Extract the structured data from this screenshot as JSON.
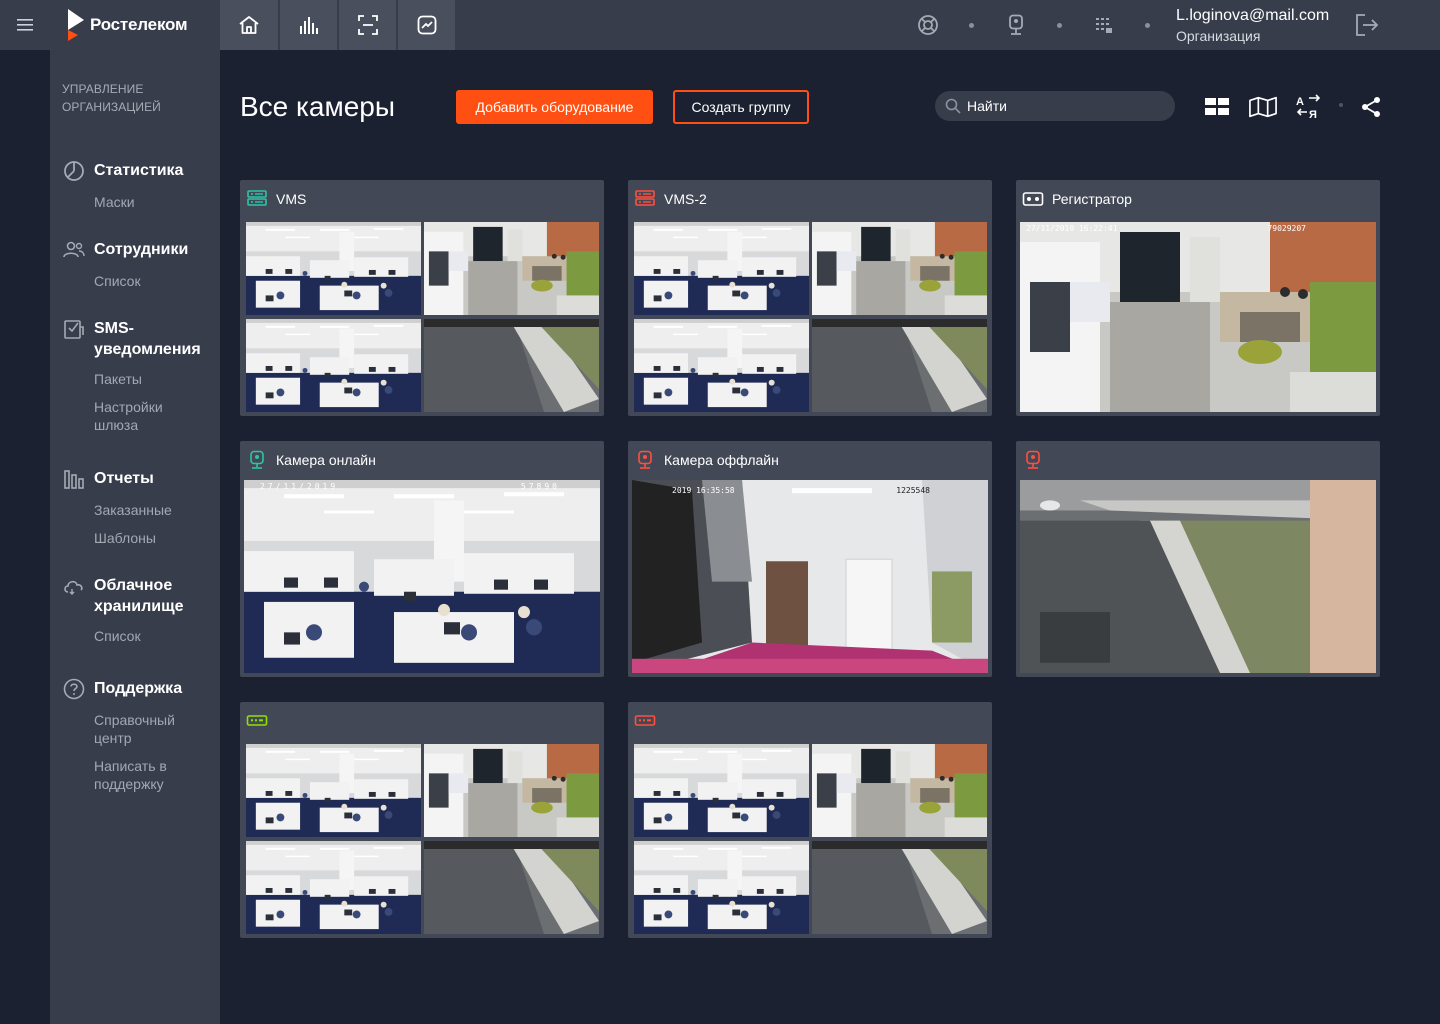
{
  "brand": {
    "name": "Ростелеком",
    "logo_accent": "#ff4f12"
  },
  "topnav": {
    "tabs": [
      {
        "icon": "home-icon"
      },
      {
        "icon": "bar-chart-icon"
      },
      {
        "icon": "scan-icon"
      },
      {
        "icon": "analytics-icon"
      }
    ],
    "tools": [
      {
        "icon": "lifebuoy-icon"
      },
      {
        "icon": "camera-icon"
      },
      {
        "icon": "building-icon"
      }
    ],
    "user_email": "L.loginova@mail.com",
    "user_org": "Организация",
    "logout_icon": "logout-icon"
  },
  "sidebar": {
    "section_line1": "Управление",
    "section_line2": "организацией",
    "groups": [
      {
        "icon": "chart-icon",
        "title": "Статистика",
        "items": [
          "Маски"
        ]
      },
      {
        "icon": "users-icon",
        "title": "Сотрудники",
        "items": [
          "Список"
        ]
      },
      {
        "icon": "sms-icon",
        "title": "SMS-уведомления",
        "title_line1": "SMS-",
        "title_line2": "уведомления",
        "items": [
          "Пакеты",
          "Настройки шлюза"
        ]
      },
      {
        "icon": "reports-icon",
        "title": "Отчеты",
        "items": [
          "Заказанные",
          "Шаблоны"
        ]
      },
      {
        "icon": "cloud-icon",
        "title": "Облачное хранилище",
        "title_line1": "Облачное",
        "title_line2": "хранилище",
        "items": [
          "Список"
        ]
      },
      {
        "icon": "help-icon",
        "title": "Поддержка",
        "items": [
          "Справочный центр",
          "Написать в поддержку"
        ]
      }
    ]
  },
  "main": {
    "title": "Все камеры",
    "add_button": "Добавить оборудование",
    "group_button": "Создать группу",
    "search_placeholder": "Найти",
    "view_controls": [
      "grid-view-icon",
      "map-view-icon",
      "sort-az-icon",
      "share-icon"
    ]
  },
  "tiles": [
    {
      "name": "VMS",
      "icon": "server-icon",
      "icon_color": "#2ec4a6",
      "kind": "grid"
    },
    {
      "name": "VMS-2",
      "icon": "server-icon",
      "icon_color": "#ff4f3d",
      "kind": "grid"
    },
    {
      "name": "Регистратор",
      "icon": "recorder-icon",
      "icon_color": "#ffffff",
      "kind": "lobby",
      "overlay_left": "27/11/2019 16:22:41",
      "overlay_right": "79029207"
    },
    {
      "name": "Камера онлайн",
      "icon": "camera-icon",
      "icon_color": "#2ec4a6",
      "kind": "office",
      "overlay_left": "27/11/2019",
      "overlay_right": "57890"
    },
    {
      "name": "Камера оффлайн",
      "icon": "camera-icon",
      "icon_color": "#ff4f3d",
      "kind": "corridor",
      "overlay_left": "2019 16:35:58",
      "overlay_right": "1225548"
    },
    {
      "name": "",
      "icon": "camera-icon",
      "icon_color": "#ff4f3d",
      "kind": "outdoor"
    },
    {
      "name": "",
      "icon": "nvr-icon",
      "icon_color": "#8fe000",
      "kind": "grid"
    },
    {
      "name": "",
      "icon": "nvr-icon",
      "icon_color": "#ff4f3d",
      "kind": "grid"
    }
  ]
}
